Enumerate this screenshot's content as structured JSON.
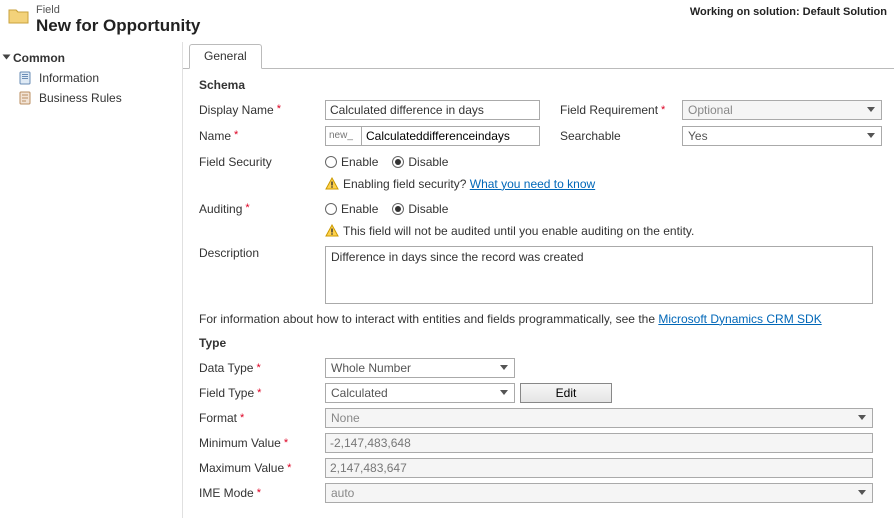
{
  "header": {
    "crumb": "Field",
    "title": "New for Opportunity",
    "working": "Working on solution: Default Solution"
  },
  "sidebar": {
    "section": "Common",
    "items": [
      {
        "label": "Information"
      },
      {
        "label": "Business Rules"
      }
    ]
  },
  "tabs": {
    "general": "General"
  },
  "schema": {
    "heading": "Schema",
    "displayName_lbl": "Display Name",
    "displayName_val": "Calculated difference in days",
    "fieldReq_lbl": "Field Requirement",
    "fieldReq_val": "Optional",
    "name_lbl": "Name",
    "name_prefix": "new_",
    "name_val": "Calculateddifferenceindays",
    "searchable_lbl": "Searchable",
    "searchable_val": "Yes",
    "fieldSecurity_lbl": "Field Security",
    "enable": "Enable",
    "disable": "Disable",
    "fs_hint1": "Enabling field security?",
    "fs_hint2": "What you need to know",
    "auditing_lbl": "Auditing",
    "aud_hint": "This field will not be audited until you enable auditing on the entity.",
    "description_lbl": "Description",
    "description_val": "Difference in days since the record was created",
    "sdk_pre": "For information about how to interact with entities and fields programmatically, see the ",
    "sdk_link": "Microsoft Dynamics CRM SDK"
  },
  "type": {
    "heading": "Type",
    "dataType_lbl": "Data Type",
    "dataType_val": "Whole Number",
    "fieldType_lbl": "Field Type",
    "fieldType_val": "Calculated",
    "edit_btn": "Edit",
    "format_lbl": "Format",
    "format_val": "None",
    "min_lbl": "Minimum Value",
    "min_val": "-2,147,483,648",
    "max_lbl": "Maximum Value",
    "max_val": "2,147,483,647",
    "ime_lbl": "IME Mode",
    "ime_val": "auto"
  }
}
